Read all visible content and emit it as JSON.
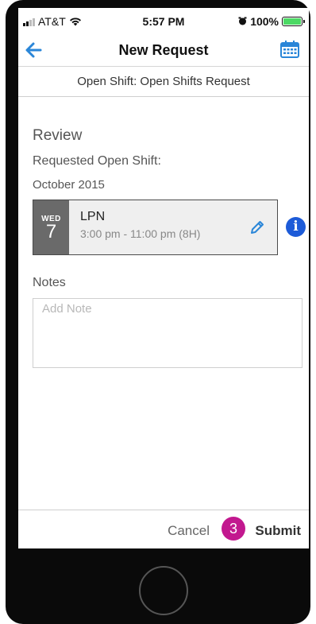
{
  "status_bar": {
    "carrier": "AT&T",
    "time": "5:57 PM",
    "battery": "100%"
  },
  "nav": {
    "title": "New Request",
    "back_icon": "arrow-left-icon",
    "calendar_icon": "calendar-icon"
  },
  "subheader": "Open Shift: Open Shifts Request",
  "review": {
    "title": "Review",
    "requested_label": "Requested Open Shift:",
    "month": "October 2015",
    "shift": {
      "day_abbr": "WED",
      "day_num": "7",
      "role": "LPN",
      "time": "3:00 pm - 11:00 pm (8H)"
    }
  },
  "notes": {
    "label": "Notes",
    "placeholder": "Add Note",
    "value": ""
  },
  "actions": {
    "cancel": "Cancel",
    "step": "3",
    "submit": "Submit"
  },
  "colors": {
    "accent_blue": "#2a86d8",
    "info_blue": "#1d5bd8",
    "step_magenta": "#c2188f",
    "date_block_gray": "#6a6a6a",
    "battery_green": "#4cd964"
  }
}
